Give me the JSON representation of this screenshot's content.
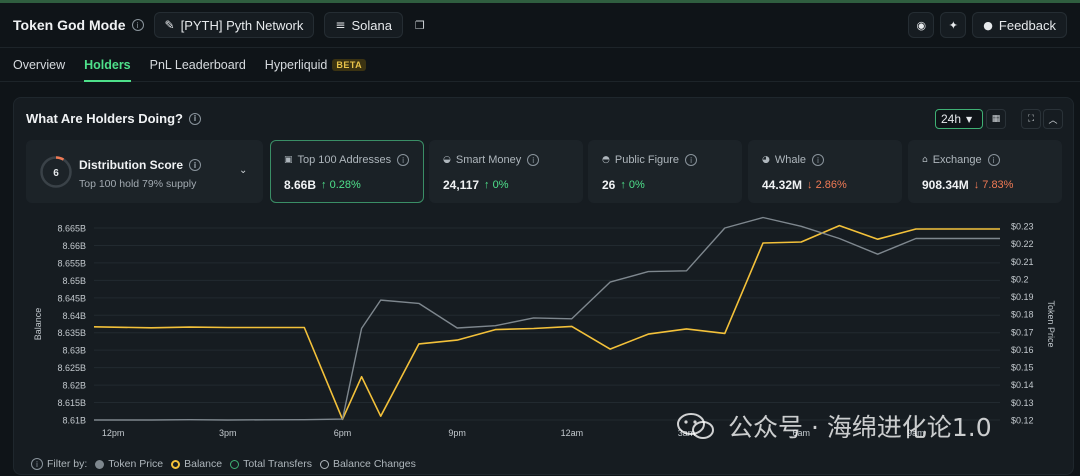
{
  "header": {
    "title": "Token God Mode",
    "token_chip": "[PYTH] Pyth Network",
    "chain_chip": "Solana",
    "feedback_label": "Feedback"
  },
  "tabs": [
    {
      "label": "Overview",
      "active": false
    },
    {
      "label": "Holders",
      "active": true
    },
    {
      "label": "PnL Leaderboard",
      "active": false
    },
    {
      "label": "Hyperliquid",
      "active": false,
      "badge": "BETA"
    }
  ],
  "panel": {
    "title": "What Are Holders Doing?",
    "timeframe": "24h"
  },
  "distribution": {
    "score": "6",
    "title": "Distribution Score",
    "subtitle": "Top 100 hold 79% supply"
  },
  "cards": [
    {
      "label": "Top 100 Addresses",
      "value": "8.66B",
      "change": "0.28%",
      "dir": "up",
      "icon": "wallet-icon",
      "selected": true
    },
    {
      "label": "Smart Money",
      "value": "24,117",
      "change": "0%",
      "dir": "up",
      "icon": "brain-icon",
      "selected": false
    },
    {
      "label": "Public Figure",
      "value": "26",
      "change": "0%",
      "dir": "up",
      "icon": "person-icon",
      "selected": false
    },
    {
      "label": "Whale",
      "value": "44.32M",
      "change": "2.86%",
      "dir": "down",
      "icon": "whale-icon",
      "selected": false
    },
    {
      "label": "Exchange",
      "value": "908.34M",
      "change": "7.83%",
      "dir": "down",
      "icon": "bank-icon",
      "selected": false
    }
  ],
  "legend": {
    "filter_label": "Filter by:",
    "items": [
      {
        "label": "Token Price",
        "color": "#7e878e",
        "selected": false
      },
      {
        "label": "Balance",
        "color": "#f3c13a",
        "selected": true
      },
      {
        "label": "Total Transfers",
        "color": "#3fb074",
        "selected": false
      },
      {
        "label": "Balance Changes",
        "color": "#aeb6bc",
        "selected": false
      }
    ]
  },
  "watermark": "公众号 · 海绵进化论1.0",
  "colors": {
    "accent": "#4ee08a",
    "balance": "#f3c13a",
    "price": "#7e878e",
    "down": "#f07a55"
  },
  "chart_data": {
    "type": "line",
    "ylabel": "Balance",
    "y2label": "Token Price",
    "y_ticks": [
      "8.665B",
      "8.66B",
      "8.655B",
      "8.65B",
      "8.645B",
      "8.64B",
      "8.635B",
      "8.63B",
      "8.625B",
      "8.62B",
      "8.615B",
      "8.61B"
    ],
    "y2_ticks": [
      "$0.23",
      "$0.22",
      "$0.21",
      "$0.2",
      "$0.19",
      "$0.18",
      "$0.17",
      "$0.16",
      "$0.15",
      "$0.14",
      "$0.13",
      "$0.12"
    ],
    "x_ticks": [
      "12pm",
      "3pm",
      "6pm",
      "9pm",
      "12am",
      "3am",
      "6am",
      "9am"
    ],
    "ylim": [
      8.61,
      8.665
    ],
    "y2lim": [
      0.12,
      0.23
    ],
    "x_hours": [
      11.5,
      13,
      14,
      15,
      16,
      17,
      18,
      18.5,
      19,
      20,
      21,
      22,
      23,
      24,
      25,
      26,
      27,
      28,
      29,
      30,
      31,
      32,
      33,
      34,
      35.2
    ],
    "series": [
      {
        "name": "Balance",
        "axis": "left",
        "color": "#f3c13a",
        "values": [
          8.6367,
          8.6364,
          8.6366,
          8.6365,
          8.6365,
          8.6365,
          8.6102,
          8.6224,
          8.6111,
          8.6318,
          8.6329,
          8.6359,
          8.6362,
          8.6368,
          8.6303,
          8.6346,
          8.6361,
          8.6348,
          8.6607,
          8.661,
          8.6657,
          8.6618,
          8.6647,
          8.6647,
          8.6647
        ]
      },
      {
        "name": "Token Price",
        "axis": "right",
        "color": "#7e878e",
        "values": [
          0.12,
          0.12,
          0.1202,
          0.12,
          0.1201,
          0.1202,
          0.1205,
          0.1725,
          0.1887,
          0.1868,
          0.1727,
          0.174,
          0.1785,
          0.178,
          0.199,
          0.205,
          0.2055,
          0.23,
          0.236,
          0.231,
          0.224,
          0.215,
          0.224,
          0.224,
          0.224
        ]
      }
    ]
  }
}
